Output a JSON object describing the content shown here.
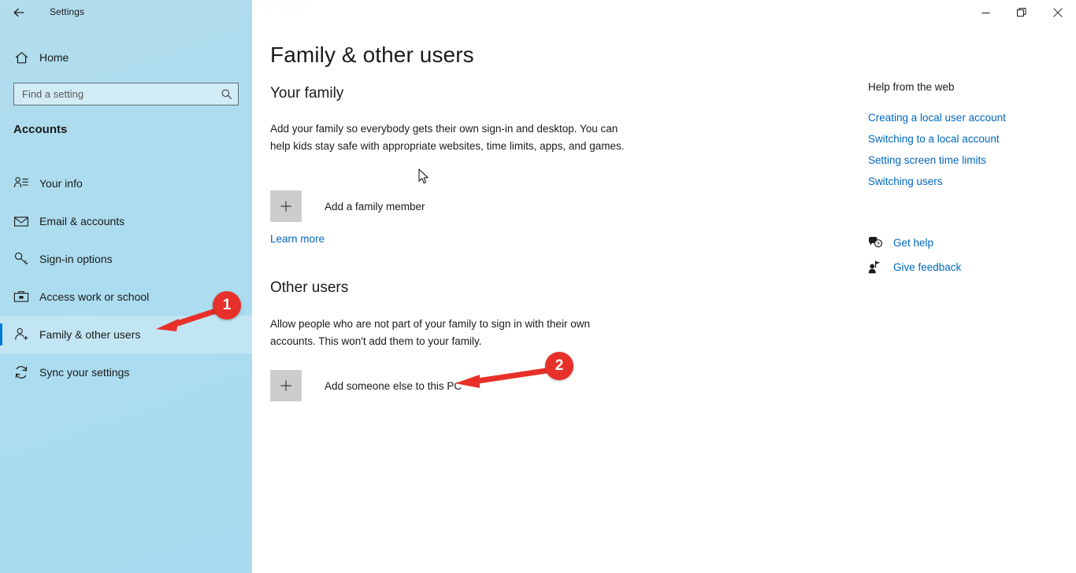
{
  "titlebar": {
    "back_icon": "back-arrow-icon",
    "title": "Settings",
    "watermark": "Settings",
    "minimize_icon": "minimize-icon",
    "restore_icon": "restore-icon",
    "close_icon": "close-icon"
  },
  "sidebar": {
    "home": {
      "label": "Home",
      "icon": "home-icon"
    },
    "search": {
      "placeholder": "Find a setting",
      "value": "",
      "icon": "search-icon"
    },
    "category": "Accounts",
    "items": [
      {
        "label": "Your info",
        "icon": "person-info-icon",
        "selected": false
      },
      {
        "label": "Email & accounts",
        "icon": "envelope-icon",
        "selected": false
      },
      {
        "label": "Sign-in options",
        "icon": "key-icon",
        "selected": false
      },
      {
        "label": "Access work or school",
        "icon": "briefcase-icon",
        "selected": false
      },
      {
        "label": "Family & other users",
        "icon": "person-add-icon",
        "selected": true
      },
      {
        "label": "Sync your settings",
        "icon": "sync-icon",
        "selected": false
      }
    ]
  },
  "main": {
    "page_title": "Family & other users",
    "sections": [
      {
        "heading": "Your family",
        "body": "Add your family so everybody gets their own sign-in and desktop. You can help kids stay safe with appropriate websites, time limits, apps, and games.",
        "action_label": "Add a family member",
        "action_icon": "plus-icon",
        "link_label": "Learn more"
      },
      {
        "heading": "Other users",
        "body": "Allow people who are not part of your family to sign in with their own accounts. This won't add them to your family.",
        "action_label": "Add someone else to this PC",
        "action_icon": "plus-icon"
      }
    ]
  },
  "help": {
    "title": "Help from the web",
    "links": [
      "Creating a local user account",
      "Switching to a local account",
      "Setting screen time limits",
      "Switching users"
    ],
    "actions": [
      {
        "label": "Get help",
        "icon": "help-bubble-icon"
      },
      {
        "label": "Give feedback",
        "icon": "feedback-person-icon"
      }
    ]
  },
  "annotations": {
    "accent_color": "#e8302a",
    "badges": [
      {
        "number": "1"
      },
      {
        "number": "2"
      }
    ]
  },
  "colors": {
    "sidebar": "#addcee",
    "accent_blue": "#0078d7",
    "link_blue": "#0067c0",
    "annotation_red": "#e8302a",
    "content_bg": "#ffffff"
  }
}
